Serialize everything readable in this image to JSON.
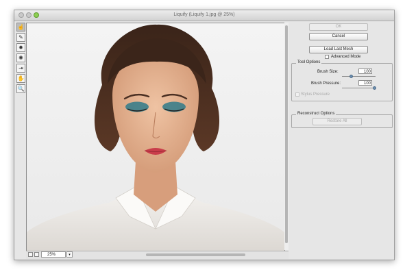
{
  "window": {
    "title": "Liquify (Liquify 1.jpg @ 25%)"
  },
  "toolbar": {
    "tools": [
      {
        "icon": "forward-warp-icon",
        "glyph": "☝"
      },
      {
        "icon": "reconstruct-icon",
        "glyph": "✎"
      },
      {
        "icon": "pucker-icon",
        "glyph": "✹"
      },
      {
        "icon": "bloat-icon",
        "glyph": "✺"
      },
      {
        "icon": "push-left-icon",
        "glyph": "⇥"
      },
      {
        "icon": "hand-icon",
        "glyph": "✋"
      },
      {
        "icon": "zoom-icon",
        "glyph": "🔍"
      }
    ]
  },
  "status": {
    "zoom": "25%"
  },
  "panel": {
    "ok_label": "OK",
    "cancel_label": "Cancel",
    "load_last_mesh_label": "Load Last Mesh",
    "advanced_mode_label": "Advanced Mode",
    "tool_options": {
      "title": "Tool Options",
      "brush_size_label": "Brush Size:",
      "brush_size_value": "100",
      "brush_pressure_label": "Brush Pressure:",
      "brush_pressure_value": "100",
      "stylus_pressure_label": "Stylus Pressure"
    },
    "reconstruct_options": {
      "title": "Reconstruct Options",
      "restore_all_label": "Restore All"
    }
  },
  "colors": {
    "eye_shadow": "#2f7a8a",
    "lipstick": "#c93d4a",
    "hair": "#4a2f22",
    "skin": "#e3b08f"
  }
}
